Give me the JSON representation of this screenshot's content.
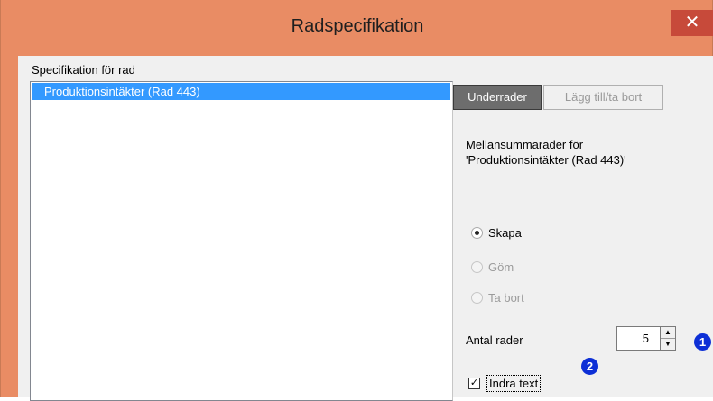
{
  "window": {
    "title": "Radspecifikation",
    "close_glyph": "✕"
  },
  "spec": {
    "label": "Specifikation för rad",
    "items": [
      {
        "label": "Produktionsintäkter (Rad 443)",
        "selected": true
      }
    ]
  },
  "tabs": {
    "underrader": "Underrader",
    "lagg_till": "Lägg till/ta bort"
  },
  "panel": {
    "description": "Mellansummarader för\n'Produktionsintäkter (Rad 443)'",
    "radios": [
      {
        "label": "Skapa",
        "checked": true,
        "enabled": true
      },
      {
        "label": "Göm",
        "checked": false,
        "enabled": false
      },
      {
        "label": "Ta bort",
        "checked": false,
        "enabled": false
      }
    ],
    "antal_label": "Antal rader",
    "antal_value": "5",
    "spin_up": "▲",
    "spin_down": "▼",
    "checkbox_label": "Indra text",
    "checkbox_checked": true,
    "checkbox_mark": "✓"
  },
  "callouts": {
    "one": "1",
    "two": "2"
  },
  "colors": {
    "title_bar": "#e98c64",
    "close_button": "#c74a3a",
    "selection": "#3399ff",
    "callout": "#0d2fd6"
  }
}
